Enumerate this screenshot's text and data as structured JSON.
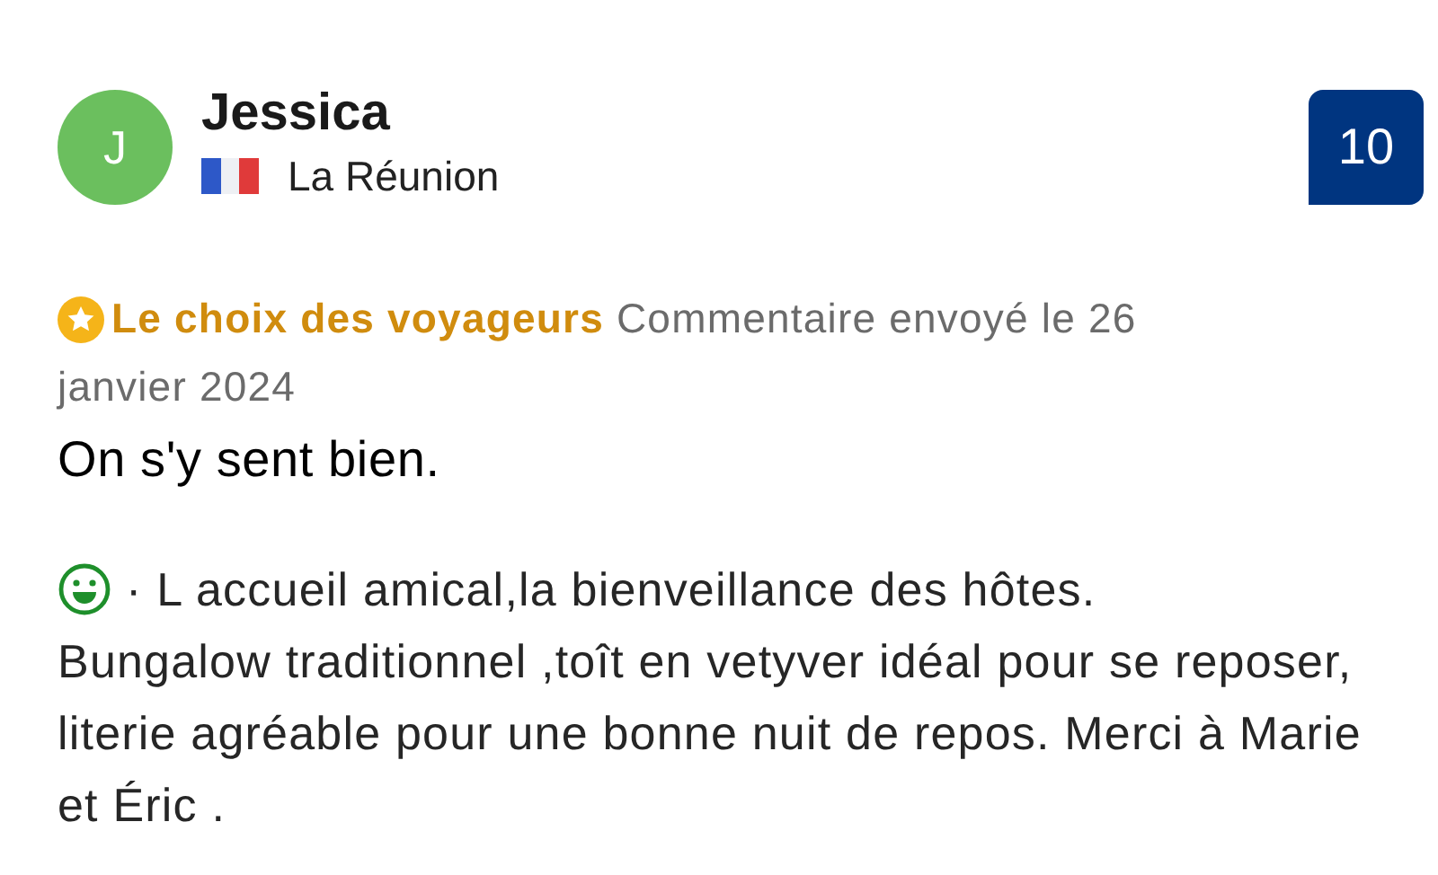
{
  "reviewer": {
    "initial": "J",
    "name": "Jessica",
    "country": "La Réunion"
  },
  "score": "10",
  "badge": "Le choix des voyageurs",
  "submitted": "Commentaire envoyé le 26 janvier 2024",
  "title": "On s'y sent bien.",
  "positive": {
    "kind": "liked",
    "text": "· L accueil amical,la bienveillance des hôtes.",
    "continued": "Bungalow traditionnel ,toît en vetyver idéal pour se reposer, literie agréable pour une bonne nuit de repos. Merci à Marie et Éric ."
  }
}
